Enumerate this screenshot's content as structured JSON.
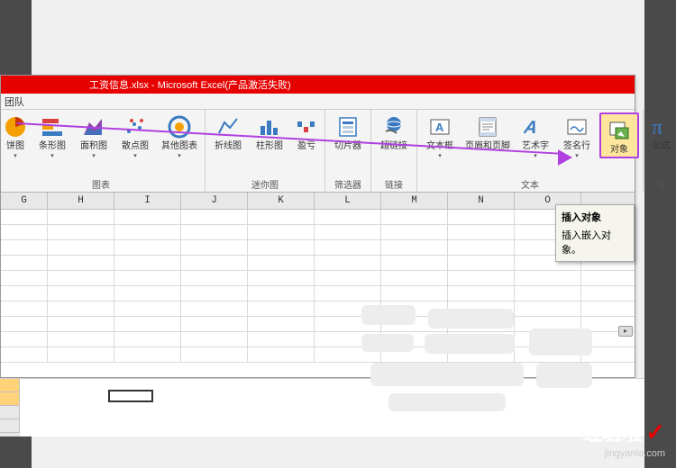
{
  "window": {
    "title": "工资信息.xlsx - Microsoft Excel(产品激活失败)",
    "tab": "团队"
  },
  "ribbon": {
    "groups": {
      "charts": {
        "label": "图表",
        "items": [
          {
            "name": "pie-chart",
            "label": "饼图"
          },
          {
            "name": "bar-chart",
            "label": "条形图"
          },
          {
            "name": "area-chart",
            "label": "面积图"
          },
          {
            "name": "scatter-chart",
            "label": "散点图"
          },
          {
            "name": "other-charts",
            "label": "其他图表"
          }
        ]
      },
      "sparklines": {
        "label": "迷你图",
        "items": [
          {
            "name": "sparkline-line",
            "label": "折线图"
          },
          {
            "name": "sparkline-column",
            "label": "柱形图"
          },
          {
            "name": "sparkline-winloss",
            "label": "盈亏"
          }
        ]
      },
      "filter": {
        "label": "筛选器",
        "items": [
          {
            "name": "slicer",
            "label": "切片器"
          }
        ]
      },
      "links": {
        "label": "链接",
        "items": [
          {
            "name": "hyperlink",
            "label": "超链接"
          }
        ]
      },
      "text": {
        "label": "文本",
        "items": [
          {
            "name": "textbox",
            "label": "文本框"
          },
          {
            "name": "header-footer",
            "label": "页眉和页脚"
          },
          {
            "name": "wordart",
            "label": "艺术字"
          },
          {
            "name": "signature",
            "label": "签名行"
          },
          {
            "name": "object",
            "label": "对象"
          }
        ]
      },
      "symbols": {
        "label": "符",
        "items": [
          {
            "name": "equation",
            "label": "公式"
          }
        ]
      }
    }
  },
  "columns": [
    "G",
    "H",
    "I",
    "J",
    "K",
    "L",
    "M",
    "N",
    "O"
  ],
  "tooltip": {
    "title": "插入对象",
    "body": "插入嵌入对象。"
  },
  "watermark": {
    "brand": "经验啦",
    "url": "jingyanla.com"
  }
}
